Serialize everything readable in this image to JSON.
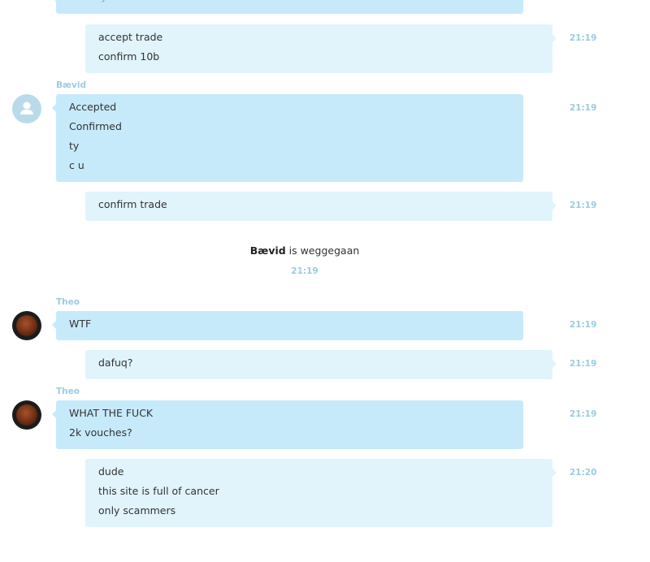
{
  "conversation": {
    "top_partial_text": "I am by the chelse",
    "messages": [
      {
        "id": "m1",
        "direction": "out",
        "lines": [
          "accept trade",
          "confirm 10b"
        ],
        "time": "21:19"
      },
      {
        "id": "m2",
        "direction": "in",
        "sender": "Bævid",
        "avatar": "default-avatar",
        "lines": [
          "Accepted",
          "Confirmed",
          "ty",
          "c u"
        ],
        "time": "21:19"
      },
      {
        "id": "m3",
        "direction": "out",
        "lines": [
          "confirm trade"
        ],
        "time": "21:19"
      },
      {
        "id": "m5",
        "direction": "in",
        "sender": "Theo",
        "avatar": "photo-avatar",
        "lines": [
          "WTF"
        ],
        "time": "21:19"
      },
      {
        "id": "m6",
        "direction": "out",
        "lines": [
          "dafuq?"
        ],
        "time": "21:19"
      },
      {
        "id": "m7",
        "direction": "in",
        "sender": "Theo",
        "avatar": "photo-avatar",
        "lines": [
          "WHAT THE FUCK",
          "2k vouches?"
        ],
        "time": "21:19"
      },
      {
        "id": "m8",
        "direction": "out",
        "lines": [
          "dude",
          "this site is full of cancer",
          "only scammers"
        ],
        "time": "21:20"
      }
    ],
    "system_event": {
      "user": "Bævid",
      "text": " is weggegaan",
      "time": "21:19"
    }
  },
  "colors": {
    "incoming_bubble": "#c7eafb",
    "outgoing_bubble": "#e1f4fc",
    "timestamp": "#9ccbe0"
  }
}
